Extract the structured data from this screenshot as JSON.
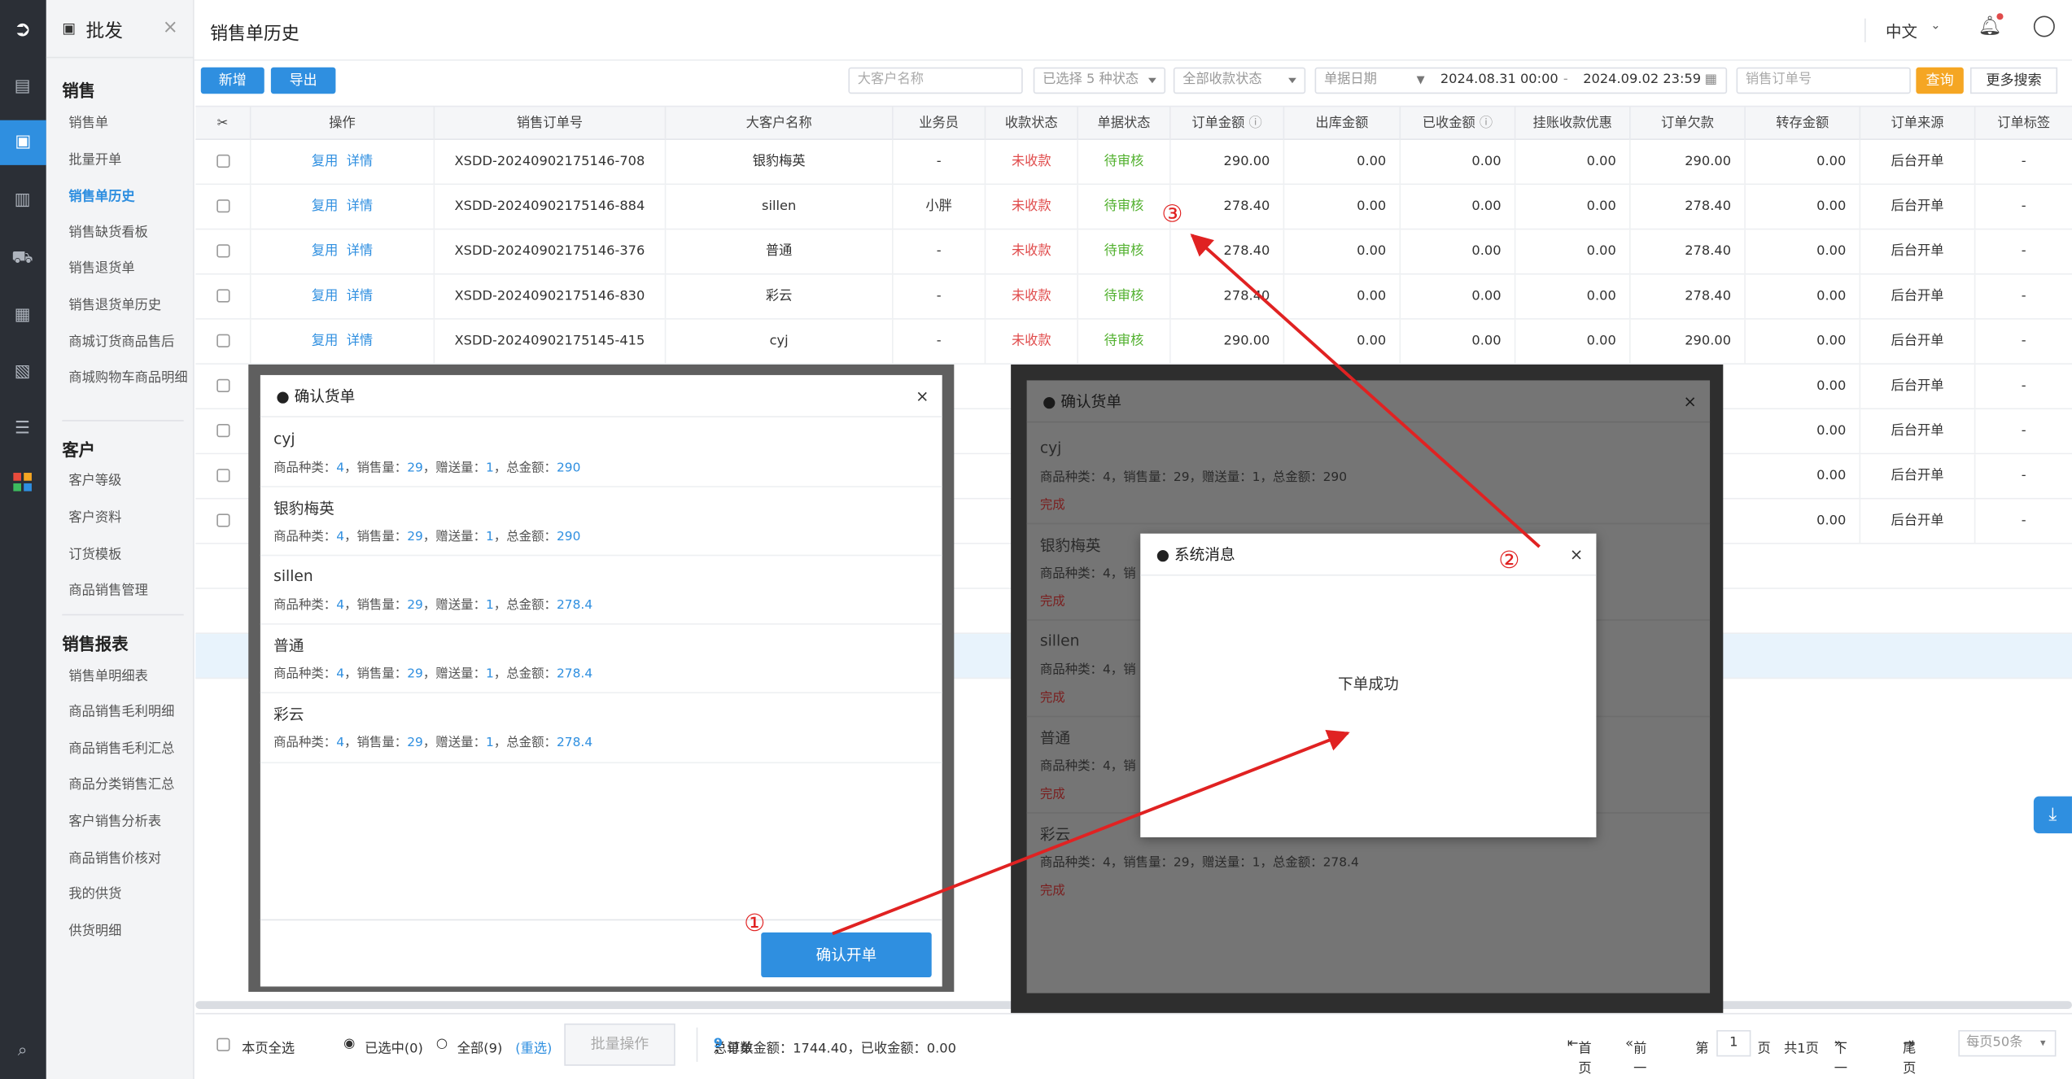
{
  "nav_rail": {
    "icons": [
      "logo-icon",
      "report-icon",
      "sales-icon",
      "book-icon",
      "truck-icon",
      "finance-icon",
      "warehouse-icon",
      "settings-icon",
      "apps-icon",
      "search-menu-icon"
    ]
  },
  "sidebar": {
    "module_title": "批发",
    "groups": [
      {
        "title": "销售",
        "items": [
          "销售单",
          "批量开单",
          "销售单历史",
          "销售缺货看板",
          "销售退货单",
          "销售退货单历史",
          "商城订货商品售后",
          "商城购物车商品明细"
        ]
      },
      {
        "title": "客户",
        "items": [
          "客户等级",
          "客户资料",
          "订货模板",
          "商品销售管理"
        ]
      },
      {
        "title": "销售报表",
        "items": [
          "销售单明细表",
          "商品销售毛利明细",
          "商品销售毛利汇总",
          "商品分类销售汇总",
          "客户销售分析表",
          "商品销售价核对",
          "我的供货",
          "供货明细"
        ]
      }
    ],
    "active_item": "销售单历史"
  },
  "header": {
    "title": "销售单历史",
    "language": "中文"
  },
  "toolbar": {
    "new_label": "新增",
    "export_label": "导出",
    "customer_placeholder": "大客户名称",
    "type_filter": "已选择 5 种状态",
    "pay_filter": "全部收款状态",
    "date_type": "单据日期",
    "date_start": "2024.08.31 00:00",
    "date_sep": "-",
    "date_end": "2024.09.02 23:59",
    "order_no_placeholder": "销售订单号",
    "query_label": "查询",
    "more_label": "更多搜索"
  },
  "table": {
    "columns": [
      "操作",
      "销售订单号",
      "大客户名称",
      "业务员",
      "收款状态",
      "单据状态",
      "订单金额",
      "出库金额",
      "已收金额",
      "挂账收款优惠",
      "订单欠款",
      "转存金额",
      "订单来源",
      "订单标签"
    ],
    "op_copy": "复用",
    "op_detail": "详情",
    "rows": [
      {
        "no": "XSDD-20240902175146-708",
        "cust": "银豹梅英",
        "sales": "-",
        "pay": "未收款",
        "status": "待审核",
        "amt": "290.00",
        "out": "0.00",
        "recv": "0.00",
        "disc": "0.00",
        "owe": "290.00",
        "trans": "0.00",
        "src": "后台开单",
        "tag": "-"
      },
      {
        "no": "XSDD-20240902175146-884",
        "cust": "sillen",
        "sales": "小胖",
        "pay": "未收款",
        "status": "待审核",
        "amt": "278.40",
        "out": "0.00",
        "recv": "0.00",
        "disc": "0.00",
        "owe": "278.40",
        "trans": "0.00",
        "src": "后台开单",
        "tag": "-"
      },
      {
        "no": "XSDD-20240902175146-376",
        "cust": "普通",
        "sales": "-",
        "pay": "未收款",
        "status": "待审核",
        "amt": "278.40",
        "out": "0.00",
        "recv": "0.00",
        "disc": "0.00",
        "owe": "278.40",
        "trans": "0.00",
        "src": "后台开单",
        "tag": "-"
      },
      {
        "no": "XSDD-20240902175146-830",
        "cust": "彩云",
        "sales": "-",
        "pay": "未收款",
        "status": "待审核",
        "amt": "278.40",
        "out": "0.00",
        "recv": "0.00",
        "disc": "0.00",
        "owe": "278.40",
        "trans": "0.00",
        "src": "后台开单",
        "tag": "-"
      },
      {
        "no": "XSDD-20240902175145-415",
        "cust": "cyj",
        "sales": "-",
        "pay": "未收款",
        "status": "待审核",
        "amt": "290.00",
        "out": "0.00",
        "recv": "0.00",
        "disc": "0.00",
        "owe": "290.00",
        "trans": "0.00",
        "src": "后台开单",
        "tag": "-"
      }
    ],
    "hidden_rows": [
      {
        "trans": "0.00",
        "src": "后台开单",
        "tag": "-"
      },
      {
        "trans": "0.00",
        "src": "后台开单",
        "tag": "-"
      },
      {
        "trans": "0.00",
        "src": "后台开单",
        "tag": "-"
      },
      {
        "trans": "0.00",
        "src": "后台开单",
        "tag": "-"
      }
    ]
  },
  "footer": {
    "select_page": "本页全选",
    "selected": "已选中(0)",
    "all": "全部(9)",
    "reselect": "(重选)",
    "batch": "批量操作",
    "summary_prefix": "总单数",
    "summary_count": "9",
    "summary_rest": "，订单金额：1744.40，已收金额：0.00",
    "first": "首页",
    "prev": "前一页",
    "page_label": "第",
    "page": "1",
    "page_unit": "页",
    "total_pages": "共1页",
    "next": "下一页",
    "last": "尾页",
    "per_page": "每页50条"
  },
  "confirm_dialog": {
    "title": "● 确认货单",
    "labels": {
      "kinds": "商品种类：",
      "qty": "，销售量：",
      "gift": "，赠送量：",
      "total": "，总金额："
    },
    "entries": [
      {
        "name": "cyj",
        "kinds": "4",
        "qty": "29",
        "gift": "1",
        "total": "290"
      },
      {
        "name": "银豹梅英",
        "kinds": "4",
        "qty": "29",
        "gift": "1",
        "total": "290"
      },
      {
        "name": "sillen",
        "kinds": "4",
        "qty": "29",
        "gift": "1",
        "total": "278.4"
      },
      {
        "name": "普通",
        "kinds": "4",
        "qty": "29",
        "gift": "1",
        "total": "278.4"
      },
      {
        "name": "彩云",
        "kinds": "4",
        "qty": "29",
        "gift": "1",
        "total": "278.4"
      }
    ],
    "confirm_label": "确认开单"
  },
  "confirm_dialog_done": {
    "title": "● 确认货单",
    "done_label": "完成",
    "entries": [
      {
        "name": "cyj",
        "line": "商品种类：4，销售量：29，赠送量：1，总金额：290"
      },
      {
        "name": "银豹梅英",
        "line": "商品种类：4，销"
      },
      {
        "name": "sillen",
        "line": "商品种类：4，销"
      },
      {
        "name": "普通",
        "line": "商品种类：4，销"
      },
      {
        "name": "彩云",
        "line": "商品种类：4，销售量：29，赠送量：1，总金额：278.4"
      }
    ]
  },
  "system_dialog": {
    "title": "● 系统消息",
    "message": "下单成功"
  },
  "annotations": {
    "m1": "①",
    "m2": "②",
    "m3": "③",
    "color": "#e02222"
  },
  "colors": {
    "primary": "#2f8fe0",
    "orange": "#f5a623",
    "red": "#e04b4b",
    "green": "#52b12f",
    "rail": "#2b2f36"
  }
}
